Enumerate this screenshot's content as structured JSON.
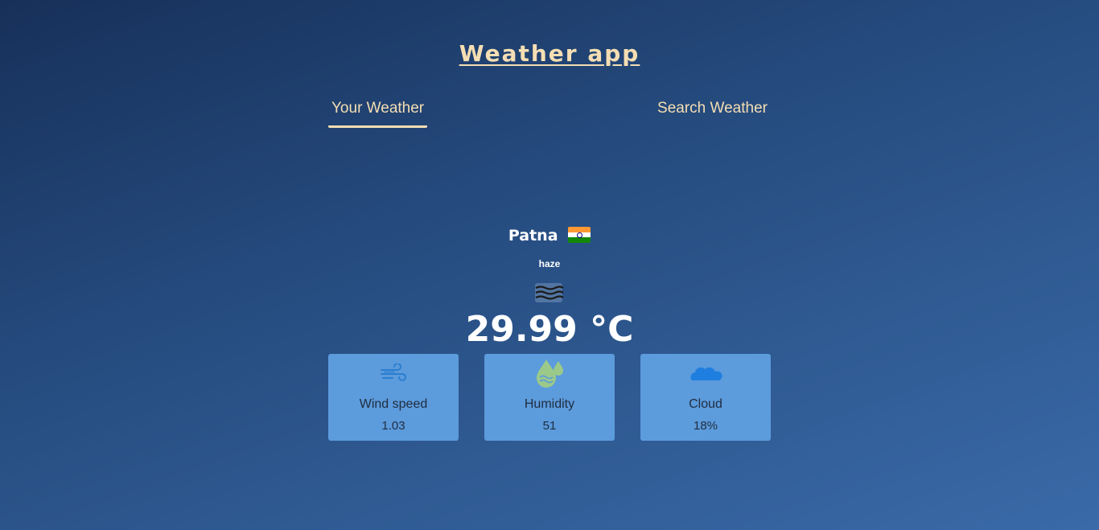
{
  "app": {
    "title": "Weather app"
  },
  "tabs": [
    {
      "label": "Your Weather",
      "active": true
    },
    {
      "label": "Search Weather",
      "active": false
    }
  ],
  "weather": {
    "city": "Patna",
    "country_flag_icon": "india-flag-icon",
    "description": "haze",
    "condition_icon": "haze-icon",
    "temperature": "29.99 °C"
  },
  "cards": {
    "wind": {
      "icon": "wind-icon",
      "label": "Wind speed",
      "value": "1.03"
    },
    "humidity": {
      "icon": "humidity-drops-icon",
      "label": "Humidity",
      "value": "51"
    },
    "cloud": {
      "icon": "cloud-icon",
      "label": "Cloud",
      "value": "18%"
    }
  },
  "colors": {
    "accent": "#f5deb3",
    "card_bg": "#5c9bdc",
    "card_text": "#1f2d3f"
  }
}
